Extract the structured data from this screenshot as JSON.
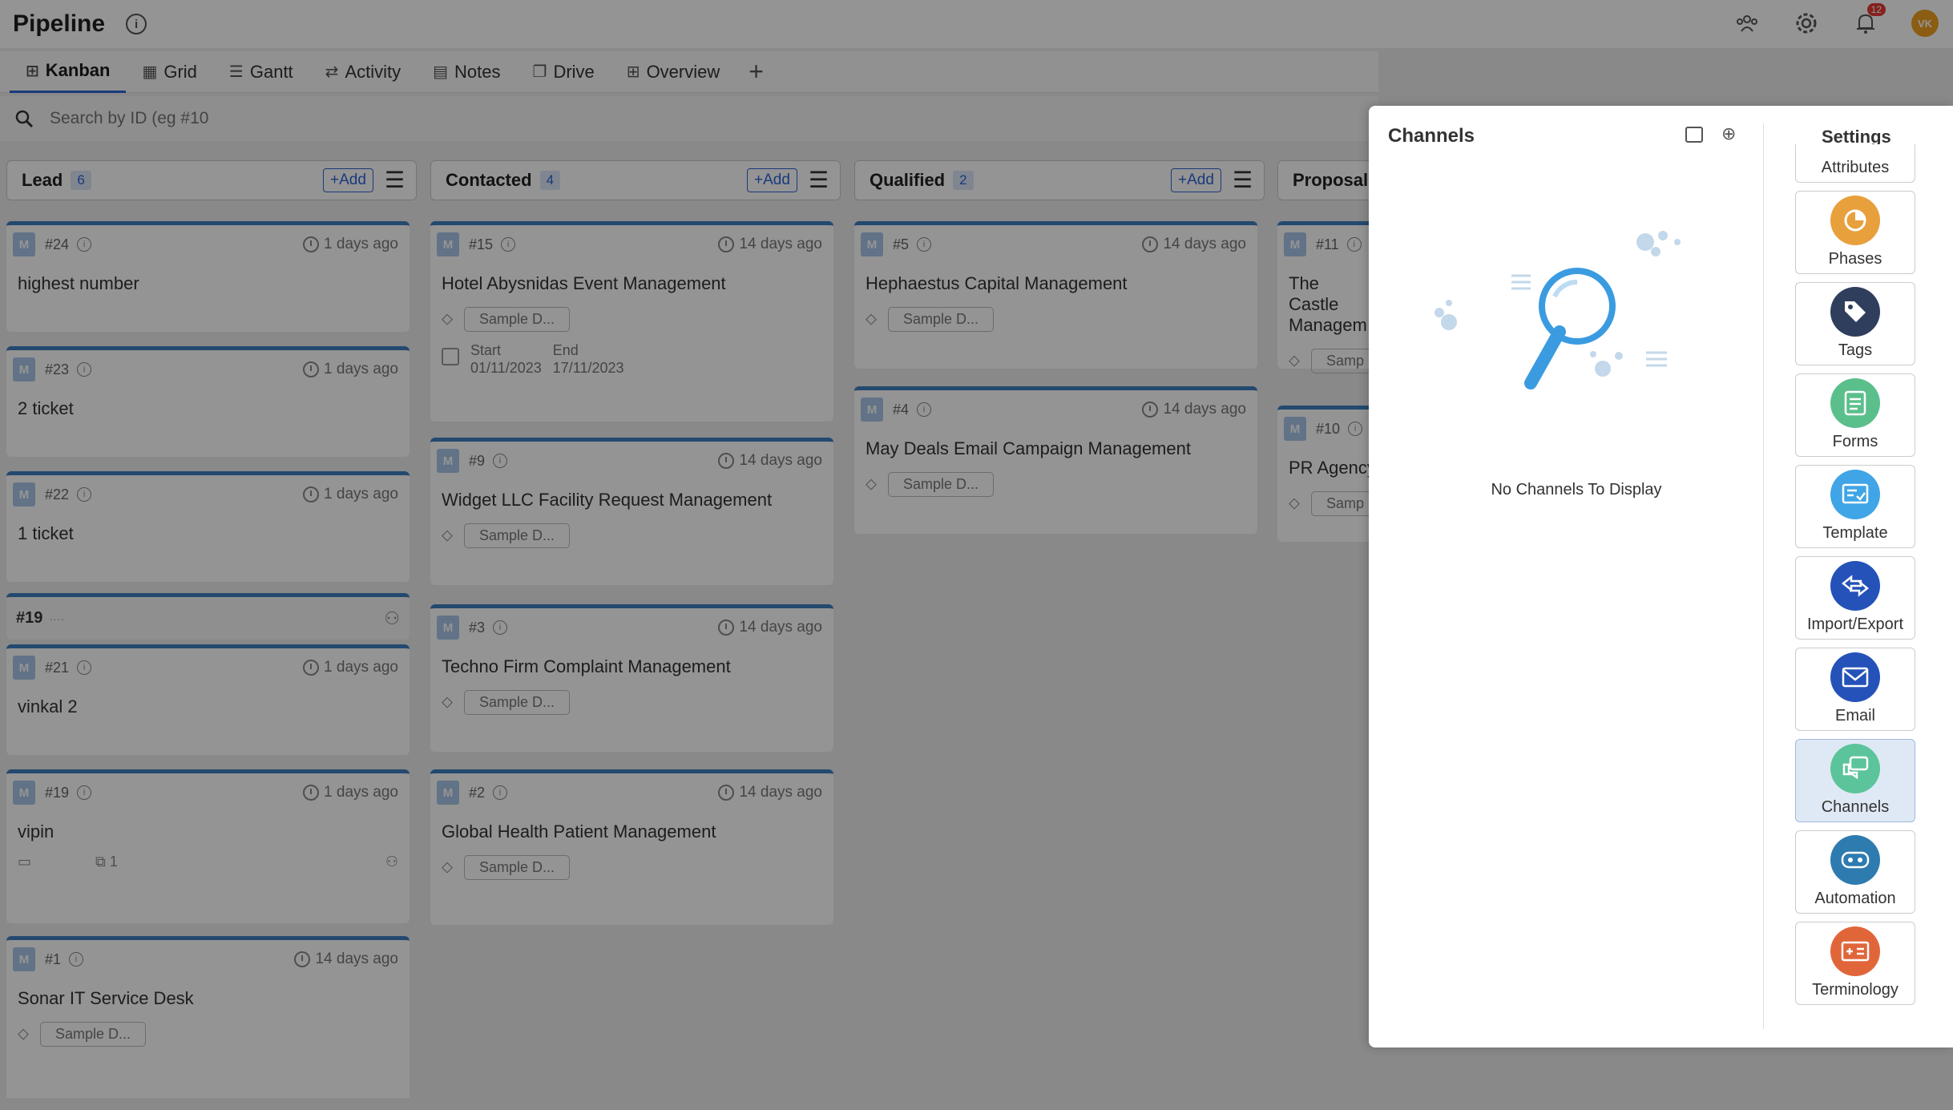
{
  "header": {
    "title": "Pipeline",
    "notification_count": "12",
    "avatar_initials": "VK"
  },
  "tabs": [
    {
      "label": "Kanban",
      "icon": "kanban-icon",
      "glyph": "⊞",
      "active": true
    },
    {
      "label": "Grid",
      "icon": "grid-icon",
      "glyph": "▦"
    },
    {
      "label": "Gantt",
      "icon": "gantt-icon",
      "glyph": "☰"
    },
    {
      "label": "Activity",
      "icon": "activity-icon",
      "glyph": "⇄"
    },
    {
      "label": "Notes",
      "icon": "notes-icon",
      "glyph": "▤"
    },
    {
      "label": "Drive",
      "icon": "drive-icon",
      "glyph": "❐"
    },
    {
      "label": "Overview",
      "icon": "overview-icon",
      "glyph": "⊞"
    }
  ],
  "search": {
    "placeholder": "Search by ID (eg #10"
  },
  "columns": {
    "lead": {
      "title": "Lead",
      "count": "6",
      "add": "+Add"
    },
    "contacted": {
      "title": "Contacted",
      "count": "4",
      "add": "+Add"
    },
    "qualified": {
      "title": "Qualified",
      "count": "2",
      "add": "+Add"
    },
    "proposal": {
      "title": "Proposal"
    }
  },
  "cards": {
    "c24": {
      "id": "#24",
      "time": "1 days ago",
      "title": "highest number"
    },
    "c23": {
      "id": "#23",
      "time": "1 days ago",
      "title": "2 ticket"
    },
    "c22": {
      "id": "#22",
      "time": "1 days ago",
      "title": "1 ticket"
    },
    "g19": {
      "title": "#19",
      "sub": "····"
    },
    "c21": {
      "id": "#21",
      "time": "1 days ago",
      "title": "vinkal 2"
    },
    "c19": {
      "id": "#19",
      "time": "1 days ago",
      "title": "vipin",
      "subtasks": "1"
    },
    "c1": {
      "id": "#1",
      "time": "14 days ago",
      "title": "Sonar IT Service Desk",
      "tag": "Sample D..."
    },
    "c15": {
      "id": "#15",
      "time": "14 days ago",
      "title": "Hotel Abysnidas Event Management",
      "tag": "Sample D...",
      "start_label": "Start",
      "start": "01/11/2023",
      "end_label": "End",
      "end": "17/11/2023"
    },
    "c9": {
      "id": "#9",
      "time": "14 days ago",
      "title": "Widget LLC Facility Request Management",
      "tag": "Sample D..."
    },
    "c3": {
      "id": "#3",
      "time": "14 days ago",
      "title": "Techno Firm Complaint Management",
      "tag": "Sample D..."
    },
    "c2": {
      "id": "#2",
      "time": "14 days ago",
      "title": "Global Health Patient Management",
      "tag": "Sample D..."
    },
    "c5": {
      "id": "#5",
      "time": "14 days ago",
      "title": "Hephaestus Capital Management",
      "tag": "Sample D..."
    },
    "c4": {
      "id": "#4",
      "time": "14 days ago",
      "title": "May Deals Email Campaign Management",
      "tag": "Sample D..."
    },
    "c11": {
      "id": "#11",
      "title": "The Castle Managem",
      "tag": "Samp"
    },
    "c10": {
      "id": "#10",
      "title": "PR Agency",
      "tag": "Samp"
    }
  },
  "avatar_letter": "M",
  "panel": {
    "title": "Channels",
    "empty_text": "No Channels To Display",
    "settings_title": "Settings",
    "settings_items": [
      {
        "label": "Attributes",
        "icon": "attributes-icon"
      },
      {
        "label": "Phases",
        "icon": "phases-icon",
        "color": "#e8a03c"
      },
      {
        "label": "Tags",
        "icon": "tags-icon",
        "color": "#2f3e5c"
      },
      {
        "label": "Forms",
        "icon": "forms-icon",
        "color": "#5bbf8c"
      },
      {
        "label": "Template",
        "icon": "template-icon",
        "color": "#3fa5e6"
      },
      {
        "label": "Import/Export",
        "icon": "import-export-icon",
        "color": "#2452b8"
      },
      {
        "label": "Email",
        "icon": "email-icon",
        "color": "#2452b8"
      },
      {
        "label": "Channels",
        "icon": "channels-icon",
        "color": "#5cc49a",
        "active": true
      },
      {
        "label": "Automation",
        "icon": "automation-icon",
        "color": "#2e7bb0"
      },
      {
        "label": "Terminology",
        "icon": "terminology-icon",
        "color": "#e0663a"
      }
    ]
  }
}
